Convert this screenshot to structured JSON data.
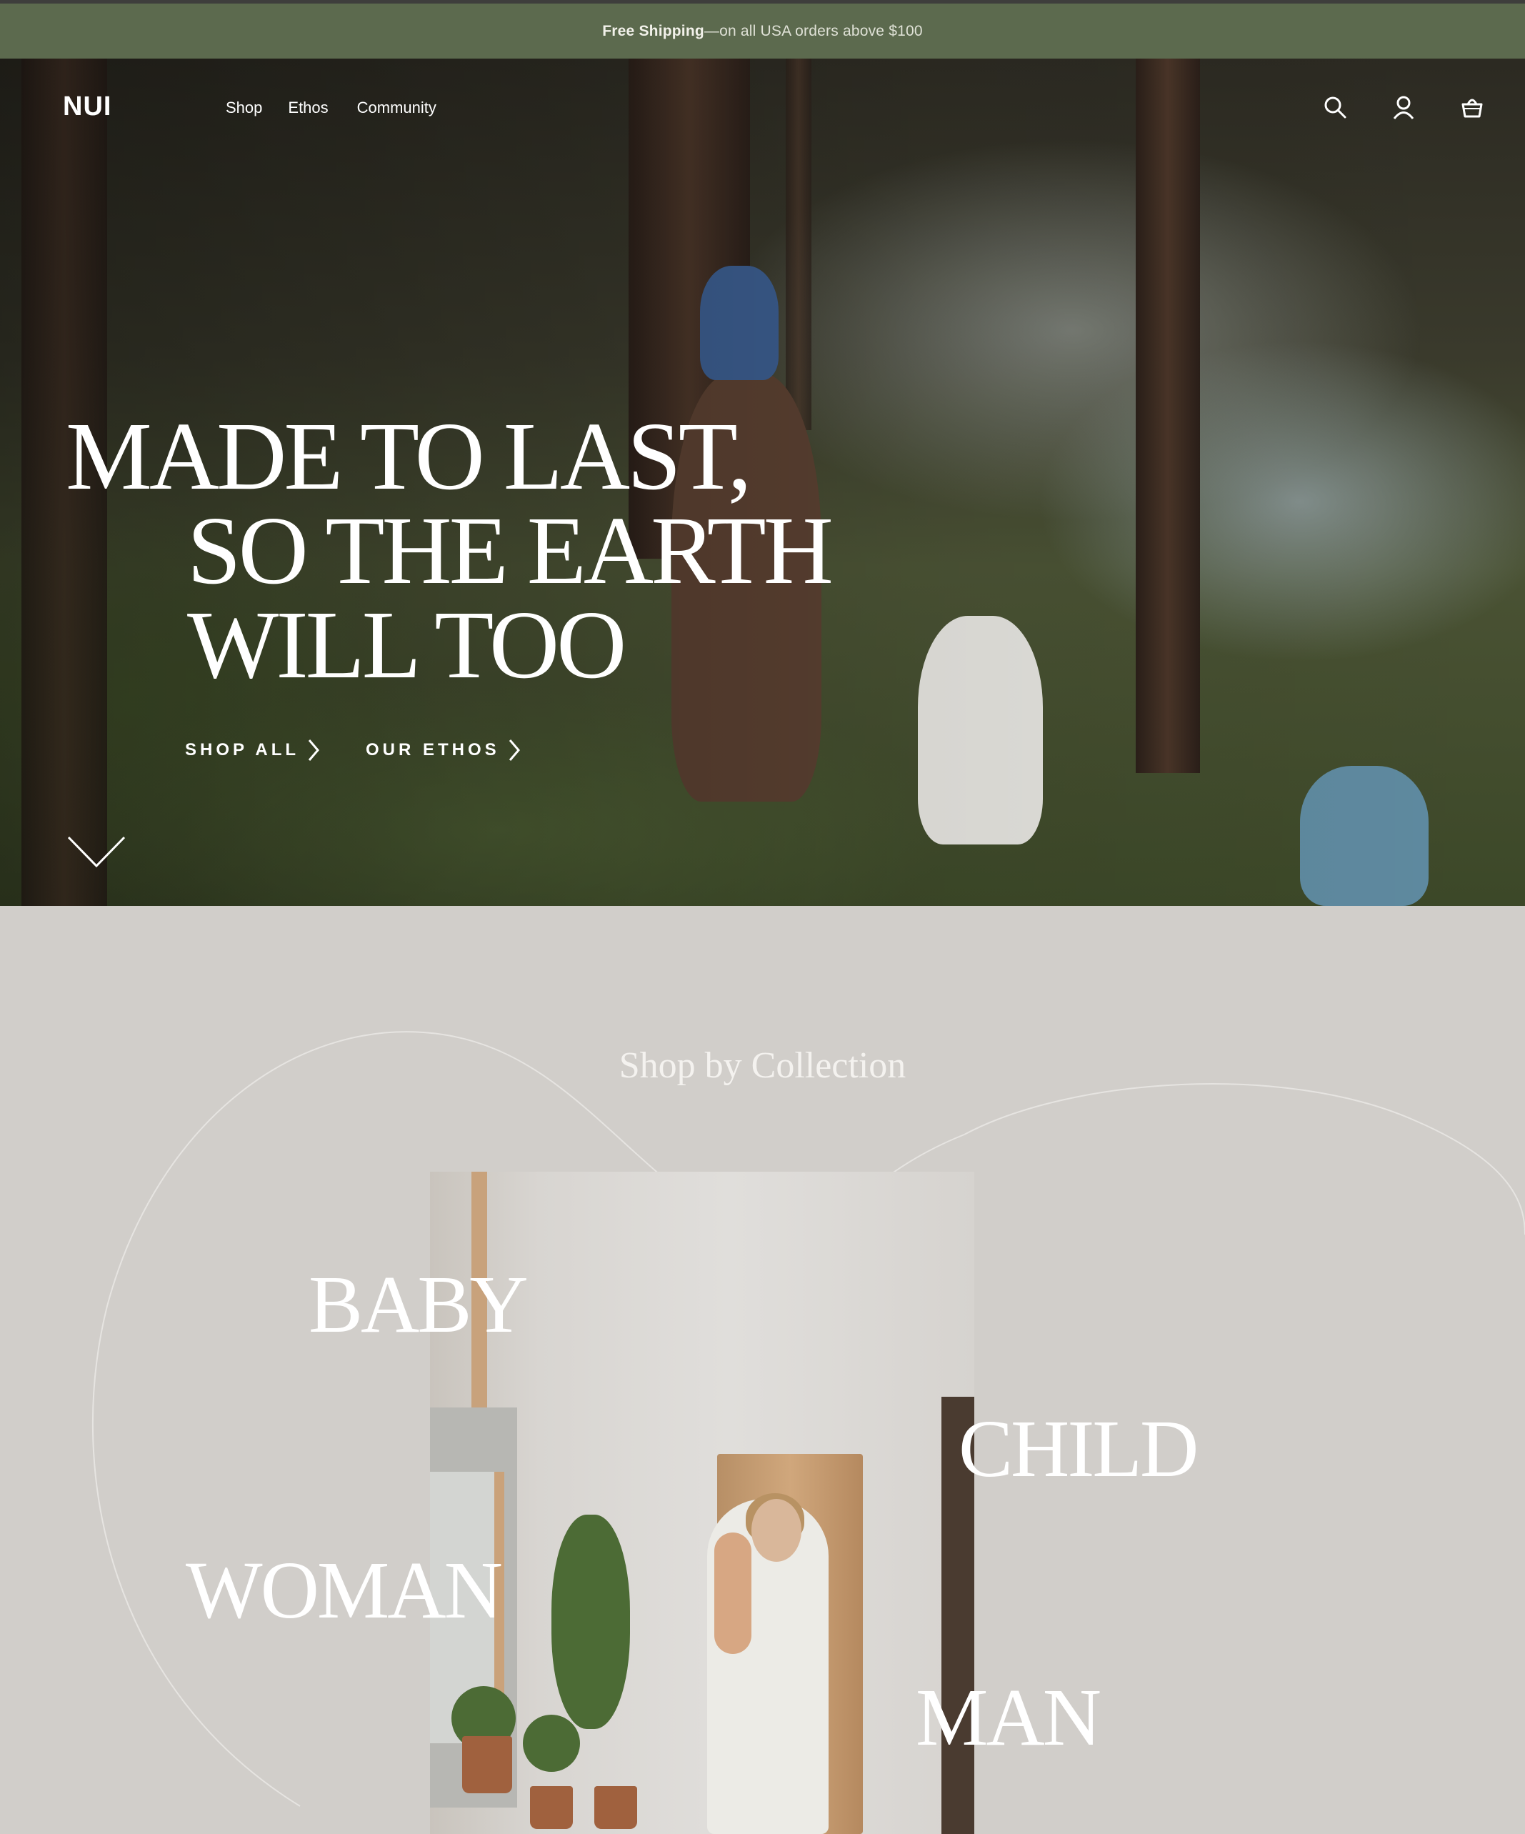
{
  "announcement": {
    "bold": "Free Shipping",
    "rest": "—on all USA orders above $100"
  },
  "header": {
    "logo": "NUI",
    "nav": [
      "Shop",
      "Ethos",
      "Community"
    ],
    "icons": [
      "search-icon",
      "account-icon",
      "cart-icon"
    ]
  },
  "hero": {
    "headline": [
      "MADE TO LAST,",
      "SO THE EARTH",
      "WILL TOO"
    ],
    "cta_shop": "SHOP ALL",
    "cta_ethos": "OUR ETHOS"
  },
  "collections": {
    "title": "Shop by Collection",
    "items": [
      "BABY",
      "CHILD",
      "WOMAN",
      "MAN"
    ]
  },
  "colors": {
    "announcement_bg": "#5c6a4e",
    "section_bg": "#d1ceca",
    "text_light": "#ffffff"
  }
}
